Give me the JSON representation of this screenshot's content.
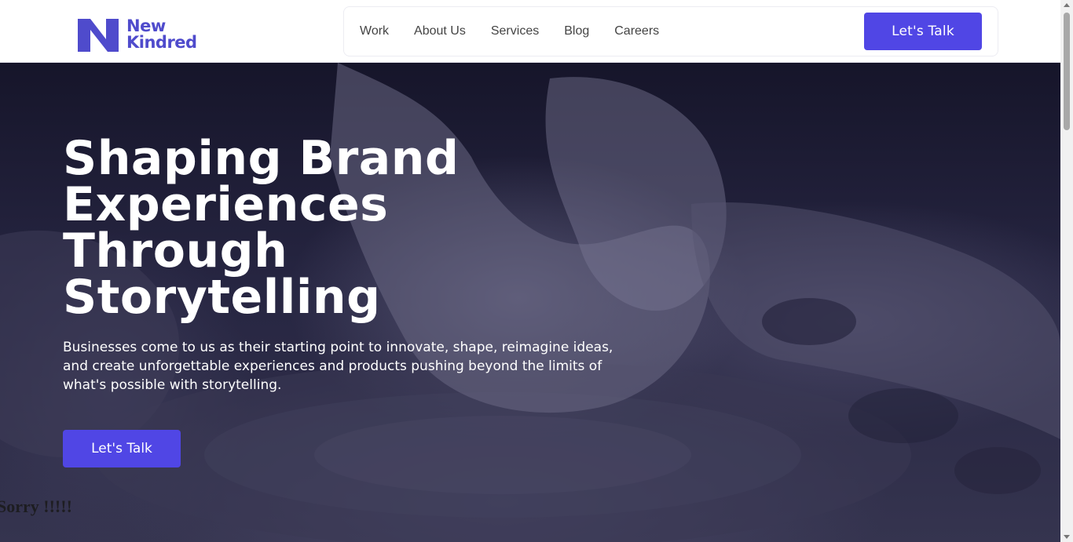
{
  "brand": {
    "name_line1": "New",
    "name_line2": "Kindred",
    "logo_icon": "n-logo-icon",
    "color": "#4f4bcc"
  },
  "nav": {
    "items": [
      {
        "label": "Work"
      },
      {
        "label": "About Us"
      },
      {
        "label": "Services"
      },
      {
        "label": "Blog"
      },
      {
        "label": "Careers"
      }
    ],
    "cta_label": "Let's Talk"
  },
  "hero": {
    "title_lines": [
      "Shaping Brand",
      "Experiences",
      "Through",
      "Storytelling"
    ],
    "description": "Businesses come to us as their starting point to innovate, shape, reimagine ideas, and create unforgettable experiences and products pushing beyond the limits of what's possible with storytelling.",
    "cta_label": "Let's Talk",
    "overlay_text": "Sorry !!!!!"
  },
  "colors": {
    "accent": "#5046e5",
    "hero_bg": "#1e1d35"
  }
}
